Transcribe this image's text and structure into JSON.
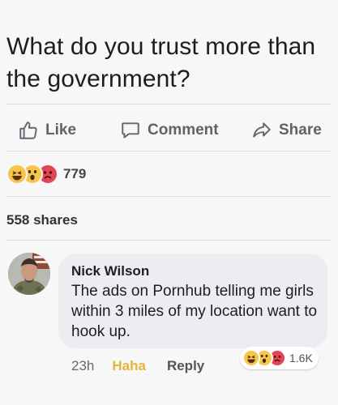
{
  "post": {
    "text": "What do you trust more than the government?"
  },
  "actions": {
    "like_label": "Like",
    "comment_label": "Comment",
    "share_label": "Share"
  },
  "reactions": {
    "count": "779",
    "types": [
      "haha",
      "wow",
      "sad"
    ]
  },
  "shares": {
    "label": "558 shares"
  },
  "comment": {
    "author": "Nick Wilson",
    "text": "The ads on Pornhub telling me girls within 3 miles of my location want to hook up.",
    "time": "23h",
    "haha_label": "Haha",
    "reply_label": "Reply",
    "reaction_count": "1.6K"
  },
  "colors": {
    "haha": "#f7c648",
    "sad": "#e24554",
    "haha_link": "#e8b33a",
    "bubble": "#ebedf0"
  },
  "icons": {
    "like": "thumbs-up-icon",
    "comment": "speech-bubble-icon",
    "share": "share-arrow-icon"
  }
}
